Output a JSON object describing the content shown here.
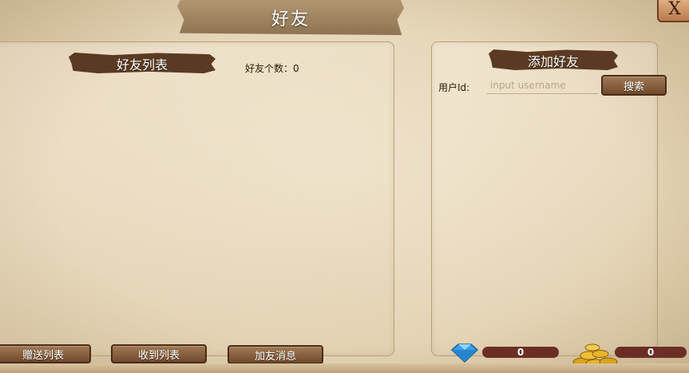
{
  "header": {
    "title": "好友",
    "close_label": "X"
  },
  "friend_list": {
    "title": "好友列表",
    "count_label": "好友个数：",
    "count_value": "0"
  },
  "add_friend": {
    "title": "添加好友",
    "user_id_label": "用户Id:",
    "input_value": "",
    "input_placeholder": "input username",
    "search_label": "搜索"
  },
  "footer": {
    "gift_list_label": "赠送列表",
    "received_list_label": "收到列表",
    "friend_messages_label": "加友消息"
  },
  "currency": {
    "gems": "0",
    "gold": "0"
  },
  "colors": {
    "accent": "#5a3a22",
    "button": "#7c5535",
    "currency_bar": "#6b2e25"
  }
}
